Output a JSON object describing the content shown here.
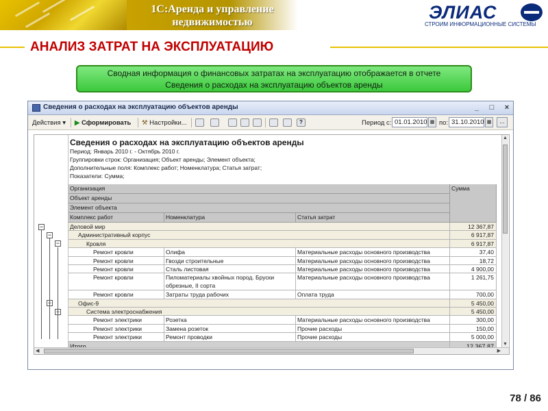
{
  "slide": {
    "title_line1": "1С:Аренда и управление",
    "title_line2": "недвижимостью",
    "logo_word": "ЭЛИАС",
    "logo_tagline": "СТРОИМ ИНФОРМАЦИОННЫЕ СИСТЕМЫ",
    "section_title": "АНАЛИЗ ЗАТРАТ НА ЭКСПЛУАТАЦИЮ",
    "banner_line1": "Сводная информация о финансовых затратах на эксплуатацию отображается в отчете",
    "banner_line2": "Сведения о расходах на эксплуатацию объектов аренды",
    "page_number": "78 / 86"
  },
  "window": {
    "title": "Сведения о расходах на эксплуатацию объектов аренды",
    "toolbar": {
      "actions_label": "Действия",
      "generate_label": "Сформировать",
      "settings_label": "Настройки...",
      "period_from_label": "Период с:",
      "period_from_value": "01.01.2010",
      "period_to_label": "по:",
      "period_to_value": "31.10.2010",
      "more_label": "..."
    }
  },
  "report": {
    "title": "Сведения о расходах на эксплуатацию объектов аренды",
    "period": "Период: Январь 2010 г. - Октябрь 2010 г.",
    "grouping": "Группировки строк: Организация; Объект аренды; Элемент объекта;",
    "extra_fields": "Дополнительные поля: Комплекс работ; Номенклатура; Статья затрат;",
    "indicators": "Показатели: Сумма;",
    "header": {
      "organization": "Организация",
      "object": "Объект аренды",
      "element": "Элемент объекта",
      "work_complex": "Комплекс работ",
      "nomenclature": "Номенклатура",
      "cost_item": "Статья затрат",
      "amount": "Сумма"
    },
    "rows": [
      {
        "a": "Деловой мир",
        "b": "",
        "c": "",
        "d": "12 367,87",
        "kind": "grp",
        "indent": 0
      },
      {
        "a": "Административный корпус",
        "b": "",
        "c": "",
        "d": "6 917,87",
        "kind": "grp",
        "indent": 1
      },
      {
        "a": "Кровля",
        "b": "",
        "c": "",
        "d": "6 917,87",
        "kind": "grp",
        "indent": 2
      },
      {
        "a": "Ремонт кровли",
        "b": "Олифа",
        "c": "Материальные расходы основного производства",
        "d": "37,40",
        "kind": "item",
        "indent": 3
      },
      {
        "a": "Ремонт кровли",
        "b": "Гвозди строительные",
        "c": "Материальные расходы основного производства",
        "d": "18,72",
        "kind": "item",
        "indent": 3
      },
      {
        "a": "Ремонт кровли",
        "b": "Сталь листовая",
        "c": "Материальные расходы основного производства",
        "d": "4 900,00",
        "kind": "item",
        "indent": 3
      },
      {
        "a": "Ремонт кровли",
        "b": "Пиломатериалы хвойных пород. Бруски",
        "b2": "обрезные, II сорта",
        "c": "Материальные расходы основного производства",
        "d": "1 261,75",
        "kind": "item2",
        "indent": 3
      },
      {
        "a": "Ремонт кровли",
        "b": "Затраты труда рабочих",
        "c": "Оплата труда",
        "d": "700,00",
        "kind": "item",
        "indent": 3
      },
      {
        "a": "Офис-9",
        "b": "",
        "c": "",
        "d": "5 450,00",
        "kind": "grp",
        "indent": 1
      },
      {
        "a": "Система электроснабжения",
        "b": "",
        "c": "",
        "d": "5 450,00",
        "kind": "grp",
        "indent": 2
      },
      {
        "a": "Ремонт электрики",
        "b": "Розетка",
        "c": "Материальные расходы основного производства",
        "d": "300,00",
        "kind": "item",
        "indent": 3
      },
      {
        "a": "Ремонт электрики",
        "b": "Замена розеток",
        "c": "Прочие расходы",
        "d": "150,00",
        "kind": "item",
        "indent": 3
      },
      {
        "a": "Ремонт электрики",
        "b": "Ремонт проводки",
        "c": "Прочие расходы",
        "d": "5 000,00",
        "kind": "item",
        "indent": 3
      }
    ],
    "total_label": "Итого",
    "total_value": "12 367,87"
  },
  "colors": {
    "accent_red": "#c00000",
    "banner_green": "#3cc93c",
    "logo_blue": "#0a2a7a",
    "gold": "#e8c200"
  }
}
